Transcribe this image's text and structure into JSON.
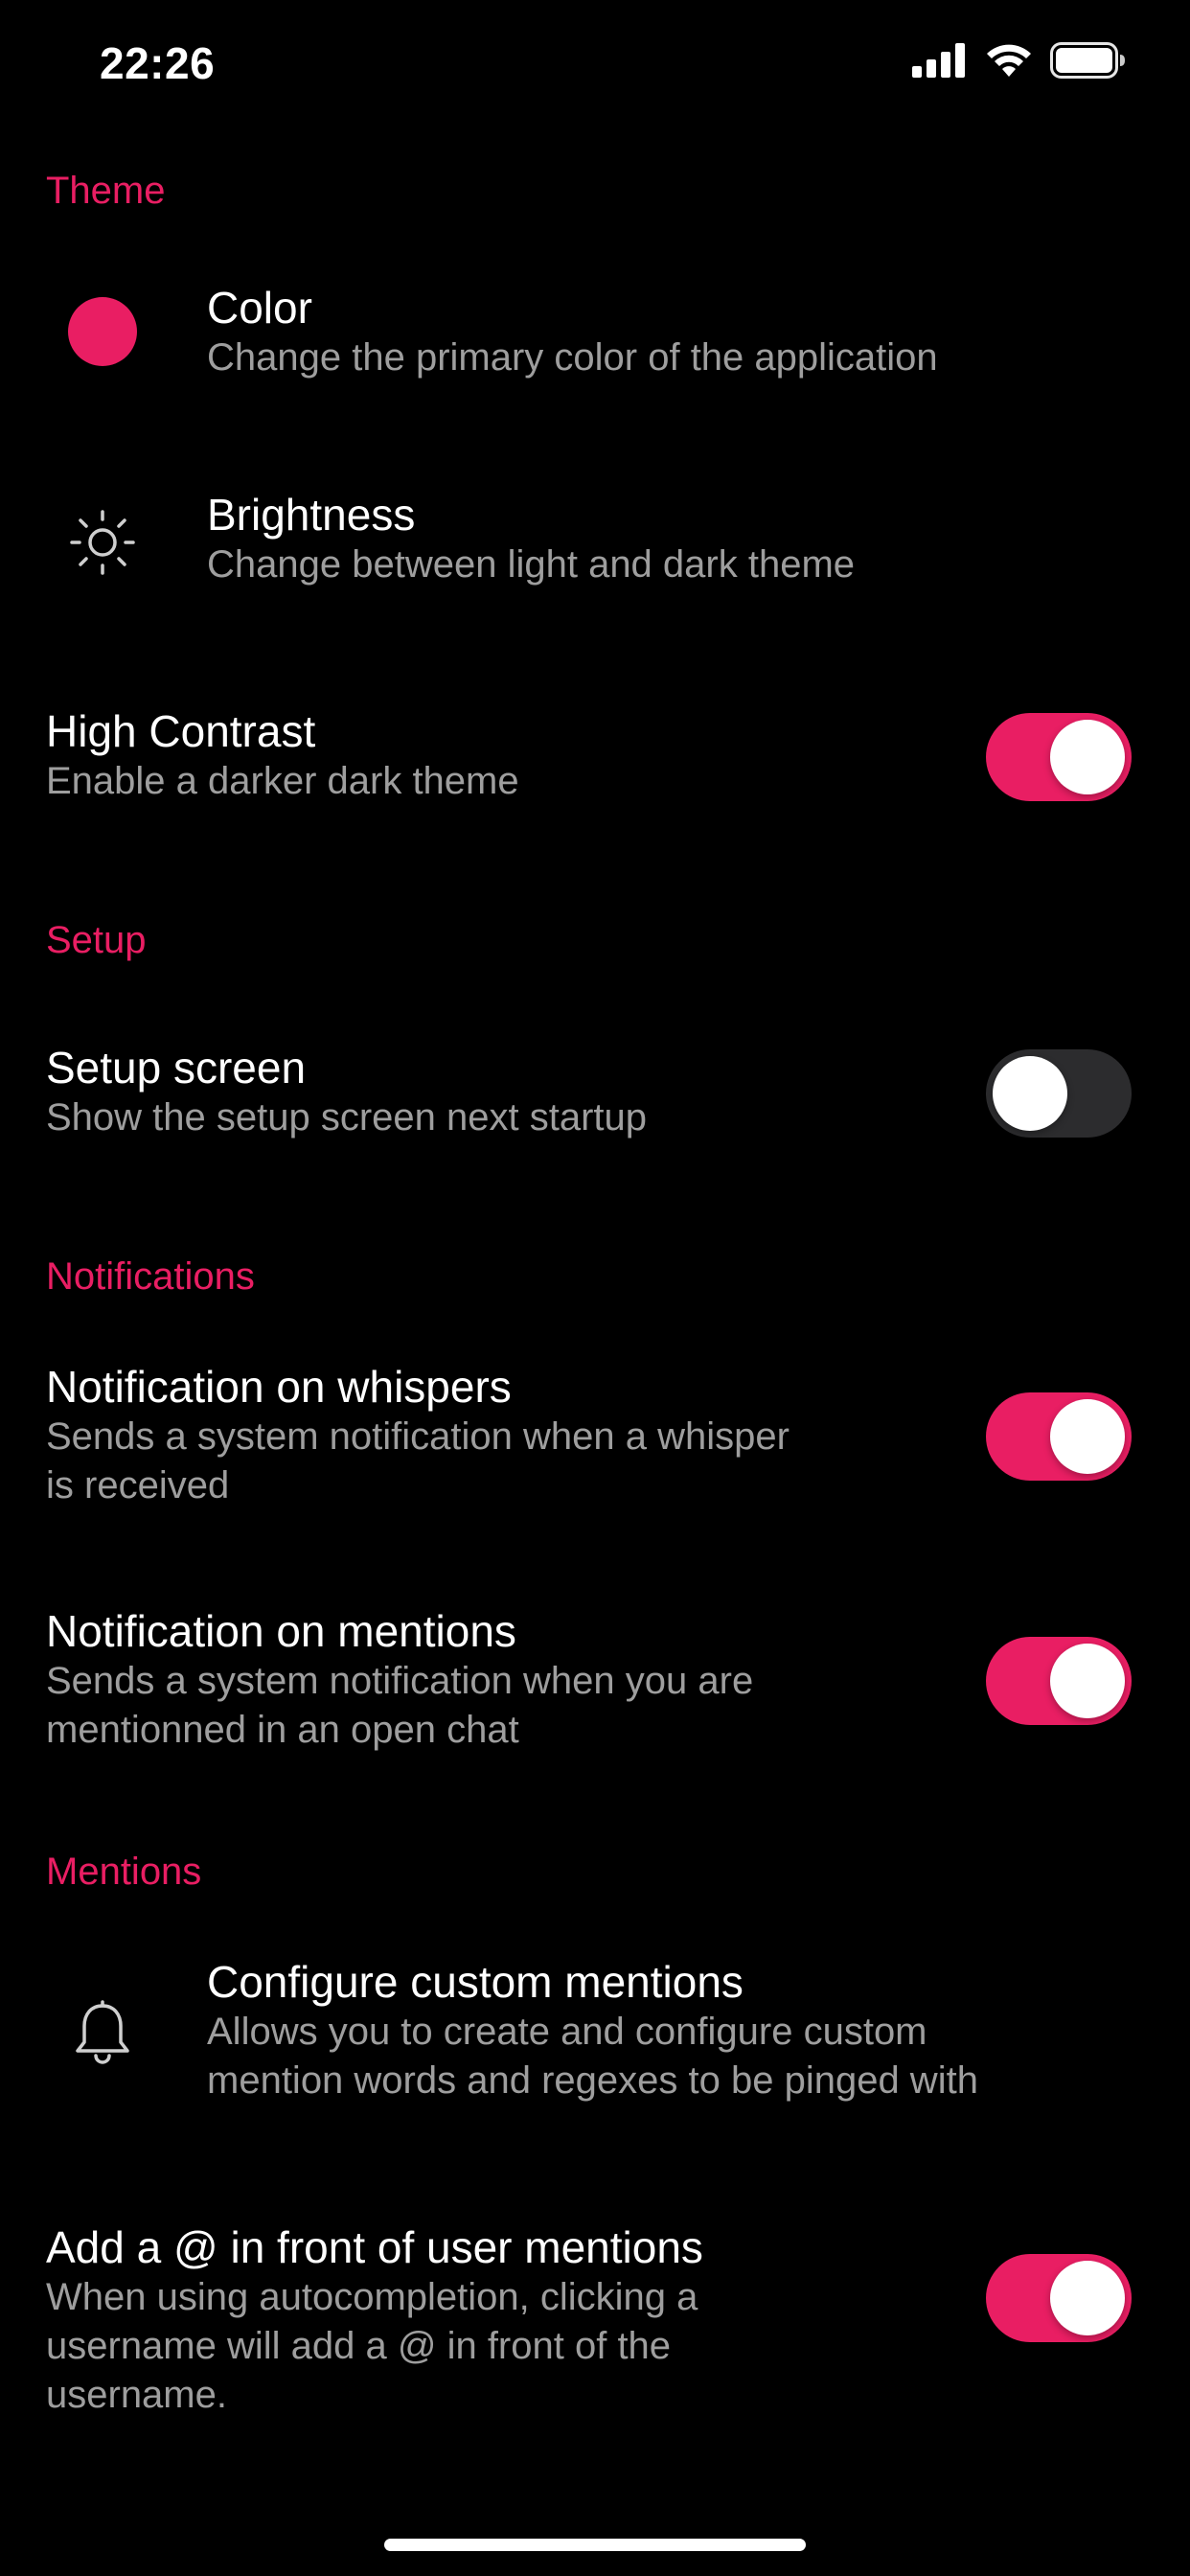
{
  "status_bar": {
    "time": "22:26",
    "signal_icon": "cellular-signal-icon",
    "wifi_icon": "wifi-icon",
    "battery_icon": "battery-icon"
  },
  "colors": {
    "accent": "#e91e63",
    "background": "#000000",
    "subtitle": "#9e9e9e",
    "toggle_off_track": "#2c2c2e"
  },
  "sections": {
    "theme": {
      "header": "Theme",
      "color": {
        "title": "Color",
        "subtitle": "Change the primary color of the application",
        "icon": "color-dot-icon"
      },
      "brightness": {
        "title": "Brightness",
        "subtitle": "Change between light and dark theme",
        "icon": "brightness-icon"
      },
      "high_contrast": {
        "title": "High Contrast",
        "subtitle": "Enable a darker dark theme",
        "enabled": true
      }
    },
    "setup": {
      "header": "Setup",
      "setup_screen": {
        "title": "Setup screen",
        "subtitle": "Show the setup screen next startup",
        "enabled": false
      }
    },
    "notifications": {
      "header": "Notifications",
      "whispers": {
        "title": "Notification on whispers",
        "subtitle_line1": "Sends a system notification when a whisper",
        "subtitle_line2": "is received",
        "enabled": true
      },
      "mentions": {
        "title": "Notification on mentions",
        "subtitle_line1": "Sends a system notification when you are",
        "subtitle_line2": "mentionned in an open chat",
        "enabled": true
      }
    },
    "mentions": {
      "header": "Mentions",
      "custom": {
        "title": "Configure custom mentions",
        "subtitle_line1": "Allows you to create and configure custom",
        "subtitle_line2": "mention words and regexes to be pinged with",
        "icon": "bell-icon"
      },
      "at_prefix": {
        "title": "Add a @ in front of user mentions",
        "subtitle_line1": "When using autocompletion, clicking a",
        "subtitle_line2": "username will add a @ in front of the",
        "subtitle_line3": "username.",
        "enabled": true
      }
    }
  }
}
